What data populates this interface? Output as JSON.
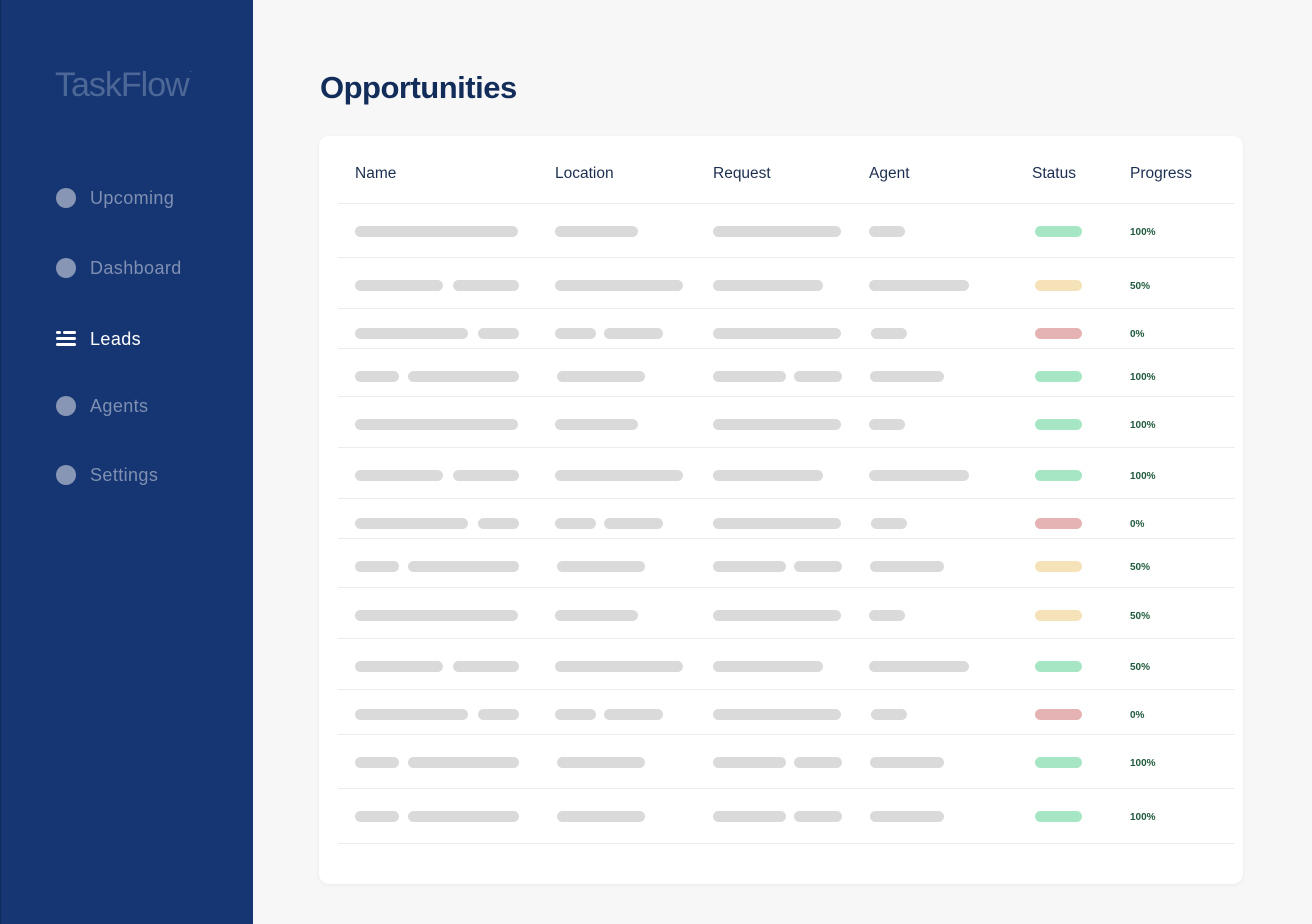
{
  "app": {
    "logo": "TaskFlow",
    "logo_mark": "·"
  },
  "sidebar": {
    "items": [
      {
        "label": "Upcoming",
        "icon": "circle-icon",
        "active": false
      },
      {
        "label": "Dashboard",
        "icon": "circle-icon",
        "active": false
      },
      {
        "label": "Leads",
        "icon": "list-icon",
        "active": true
      },
      {
        "label": "Agents",
        "icon": "circle-icon",
        "active": false
      },
      {
        "label": "Settings",
        "icon": "circle-icon",
        "active": false
      }
    ]
  },
  "page": {
    "title": "Opportunities"
  },
  "table": {
    "columns": [
      "Name",
      "Location",
      "Request",
      "Agent",
      "Status",
      "Progress"
    ],
    "status_colors": {
      "complete": "#a6e6c4",
      "pending": "#f6e2b8",
      "failed": "#e5b3b3"
    },
    "rows": [
      {
        "status": "complete",
        "progress": "100%"
      },
      {
        "status": "pending",
        "progress": "50%"
      },
      {
        "status": "failed",
        "progress": "0%"
      },
      {
        "status": "complete",
        "progress": "100%"
      },
      {
        "status": "complete",
        "progress": "100%"
      },
      {
        "status": "complete",
        "progress": "100%"
      },
      {
        "status": "failed",
        "progress": "0%"
      },
      {
        "status": "pending",
        "progress": "50%"
      },
      {
        "status": "pending",
        "progress": "50%"
      },
      {
        "status": "complete",
        "progress": "50%"
      },
      {
        "status": "failed",
        "progress": "0%"
      },
      {
        "status": "complete",
        "progress": "100%"
      },
      {
        "status": "complete",
        "progress": "100%"
      }
    ]
  },
  "colors": {
    "sidebar_bg": "#163573",
    "title": "#132d5a",
    "skeleton": "#dadada"
  }
}
